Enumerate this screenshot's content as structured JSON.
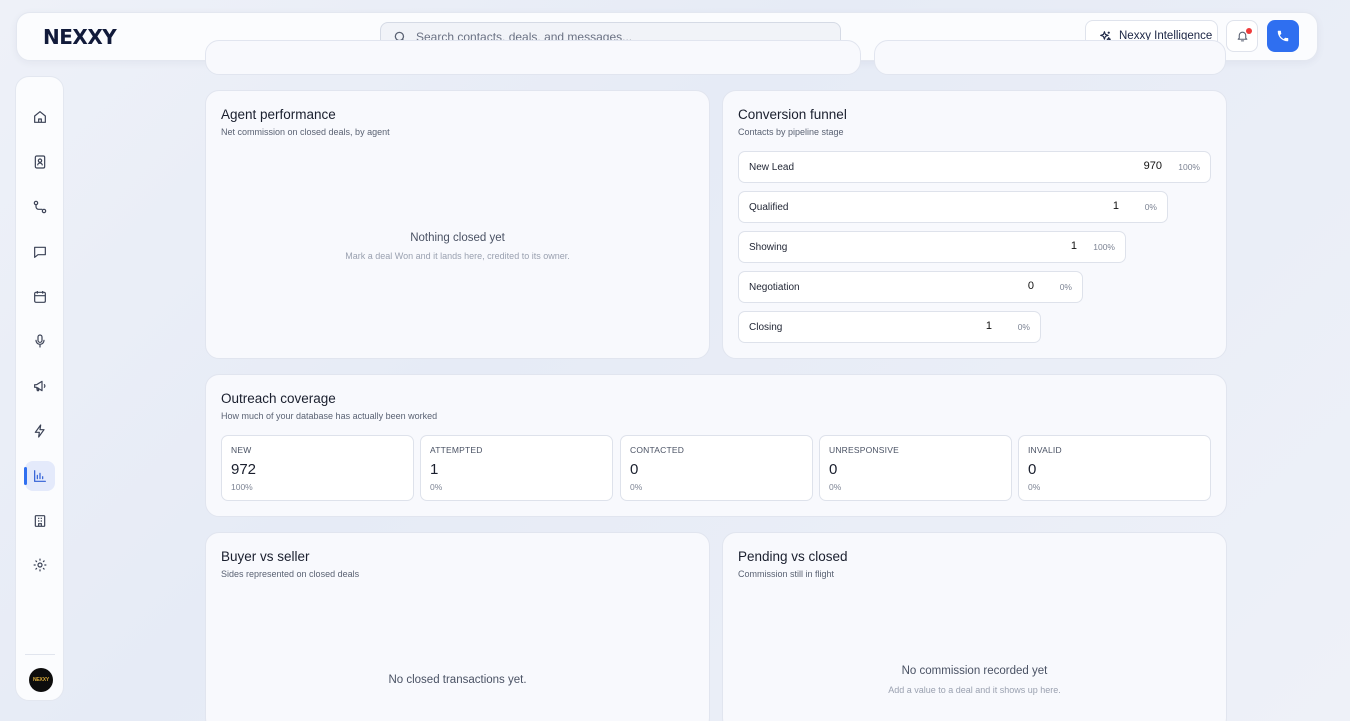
{
  "header": {
    "logo": "NEXXY",
    "search_placeholder": "Search contacts, deals, and messages...",
    "ai_button_label": "Nexxy Intelligence"
  },
  "sidebar": {
    "items": [
      {
        "name": "home",
        "icon": "home-icon"
      },
      {
        "name": "contacts",
        "icon": "contact-book-icon"
      },
      {
        "name": "pipeline",
        "icon": "route-icon"
      },
      {
        "name": "messages",
        "icon": "chat-icon"
      },
      {
        "name": "calendar",
        "icon": "calendar-icon"
      },
      {
        "name": "recordings",
        "icon": "microphone-icon"
      },
      {
        "name": "campaigns",
        "icon": "megaphone-icon"
      },
      {
        "name": "automations",
        "icon": "lightning-icon"
      },
      {
        "name": "reports",
        "icon": "bar-chart-icon",
        "active": true
      },
      {
        "name": "company",
        "icon": "building-icon"
      },
      {
        "name": "settings",
        "icon": "gear-icon"
      }
    ],
    "avatar_text": "NEXXY"
  },
  "agent_performance": {
    "title": "Agent performance",
    "subtitle": "Net commission on closed deals, by agent",
    "empty_title": "Nothing closed yet",
    "empty_sub": "Mark a deal Won and it lands here, credited to its owner."
  },
  "conversion_funnel": {
    "title": "Conversion funnel",
    "subtitle": "Contacts by pipeline stage",
    "stages": [
      {
        "label": "New Lead",
        "count": "970",
        "pct": "100%"
      },
      {
        "label": "Qualified",
        "count": "1",
        "pct": "0%"
      },
      {
        "label": "Showing",
        "count": "1",
        "pct": "100%"
      },
      {
        "label": "Negotiation",
        "count": "0",
        "pct": "0%"
      },
      {
        "label": "Closing",
        "count": "1",
        "pct": "0%"
      }
    ]
  },
  "outreach": {
    "title": "Outreach coverage",
    "subtitle": "How much of your database has actually been worked",
    "boxes": [
      {
        "label": "NEW",
        "value": "972",
        "pct": "100%"
      },
      {
        "label": "ATTEMPTED",
        "value": "1",
        "pct": "0%"
      },
      {
        "label": "CONTACTED",
        "value": "0",
        "pct": "0%"
      },
      {
        "label": "UNRESPONSIVE",
        "value": "0",
        "pct": "0%"
      },
      {
        "label": "INVALID",
        "value": "0",
        "pct": "0%"
      }
    ]
  },
  "buyer_seller": {
    "title": "Buyer vs seller",
    "subtitle": "Sides represented on closed deals",
    "empty_title": "No closed transactions yet."
  },
  "pending_closed": {
    "title": "Pending vs closed",
    "subtitle": "Commission still in flight",
    "empty_title": "No commission recorded yet",
    "empty_sub": "Add a value to a deal and it shows up here."
  }
}
